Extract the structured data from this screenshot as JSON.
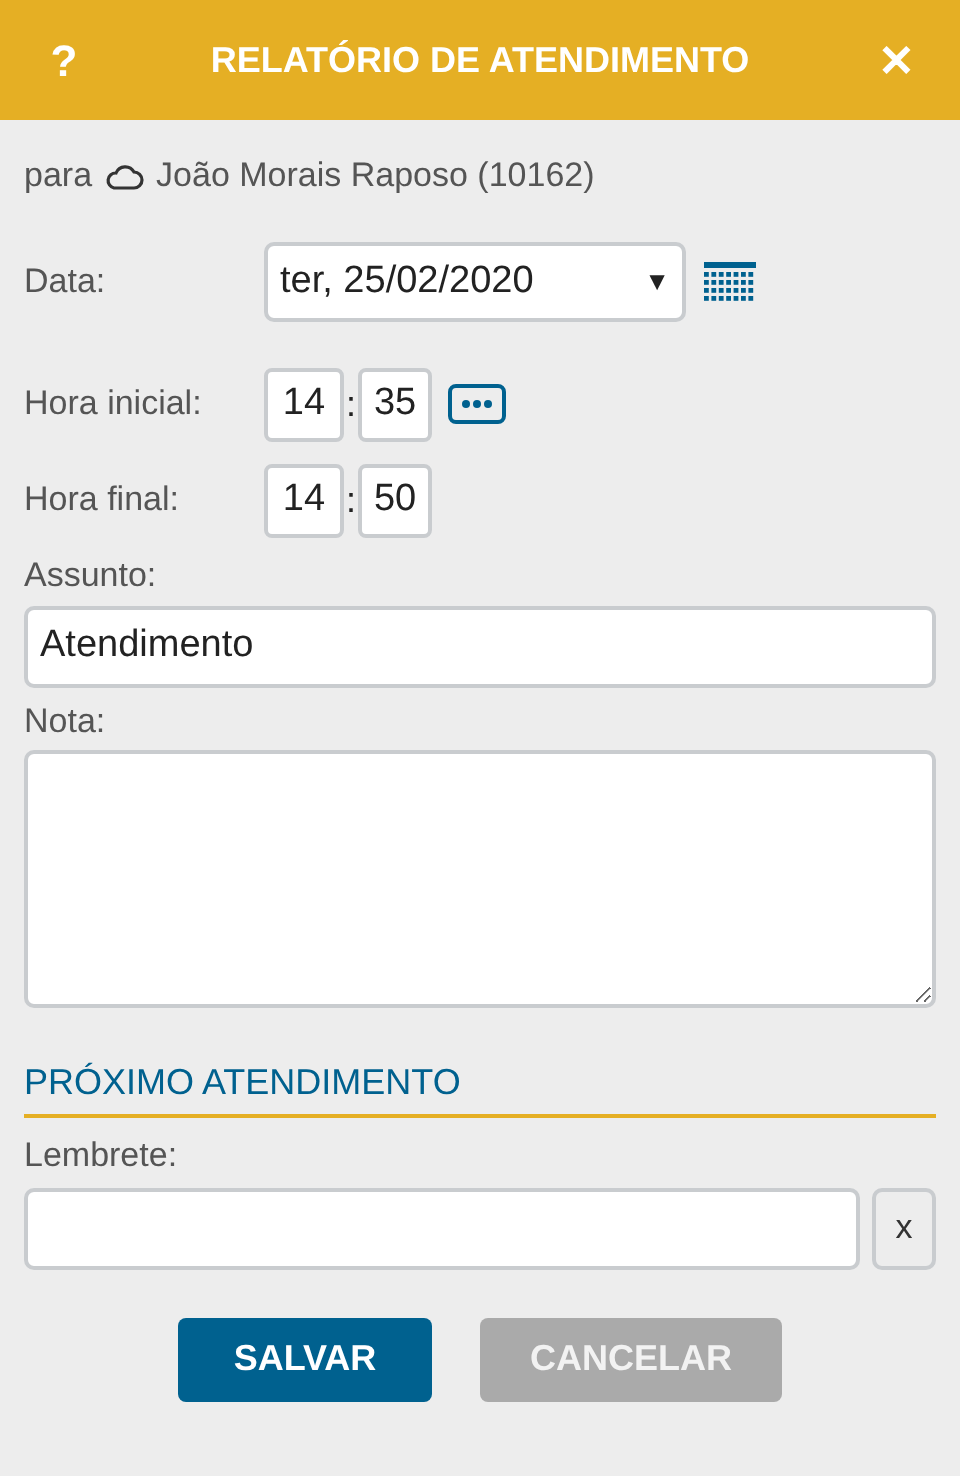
{
  "header": {
    "help": "?",
    "title": "RELATÓRIO DE ATENDIMENTO",
    "close": "✕"
  },
  "recipient": {
    "prefix": "para",
    "name": "João Morais Raposo (10162)"
  },
  "date": {
    "label": "Data:",
    "value": "ter, 25/02/2020",
    "caret": "▼"
  },
  "start_time": {
    "label": "Hora inicial:",
    "hour": "14",
    "separator": ":",
    "minute": "35"
  },
  "end_time": {
    "label": "Hora final:",
    "hour": "14",
    "separator": ":",
    "minute": "50"
  },
  "subject": {
    "label": "Assunto:",
    "value": "Atendimento"
  },
  "note": {
    "label": "Nota:"
  },
  "next_section": {
    "heading": "PRÓXIMO ATENDIMENTO",
    "reminder_label": "Lembrete:",
    "clear": "x"
  },
  "buttons": [
    {
      "label": "SALVAR",
      "kind": "primary"
    },
    {
      "label": "CANCELAR",
      "kind": "secondary"
    }
  ]
}
